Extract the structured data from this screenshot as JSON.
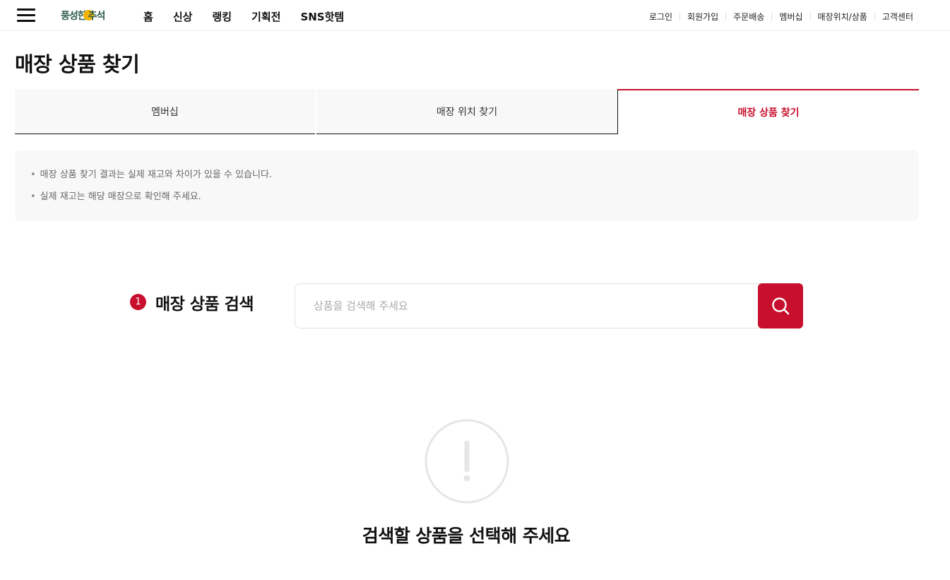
{
  "header": {
    "logo": {
      "part1": "풍성한",
      "part2": "추석"
    },
    "nav": [
      "홈",
      "신상",
      "랭킹",
      "기획전",
      "SNS핫템"
    ],
    "util_links": [
      "로그인",
      "회원가입",
      "주문배송",
      "멤버십",
      "매장위치/상품",
      "고객센터"
    ]
  },
  "page": {
    "title": "매장 상품 찾기"
  },
  "tabs": [
    {
      "label": "멤버십"
    },
    {
      "label": "매장 위치 찾기"
    },
    {
      "label": "매장 상품 찾기"
    }
  ],
  "notice": [
    "매장 상품 찾기 결과는 실제 재고와 차이가 있을 수 있습니다.",
    "실제 재고는 해당 매장으로 확인해 주세요."
  ],
  "search": {
    "step": "1",
    "label": "매장 상품 검색",
    "placeholder": "상품을 검색해 주세요",
    "value": ""
  },
  "empty": {
    "message": "검색할 상품을 선택해 주세요"
  },
  "colors": {
    "accent": "#c8102e",
    "logo": "#2d5d4c",
    "moon": "#f4b400"
  },
  "icons": {
    "menu": "hamburger-icon",
    "search": "search-icon",
    "empty": "exclamation-circle-icon"
  }
}
